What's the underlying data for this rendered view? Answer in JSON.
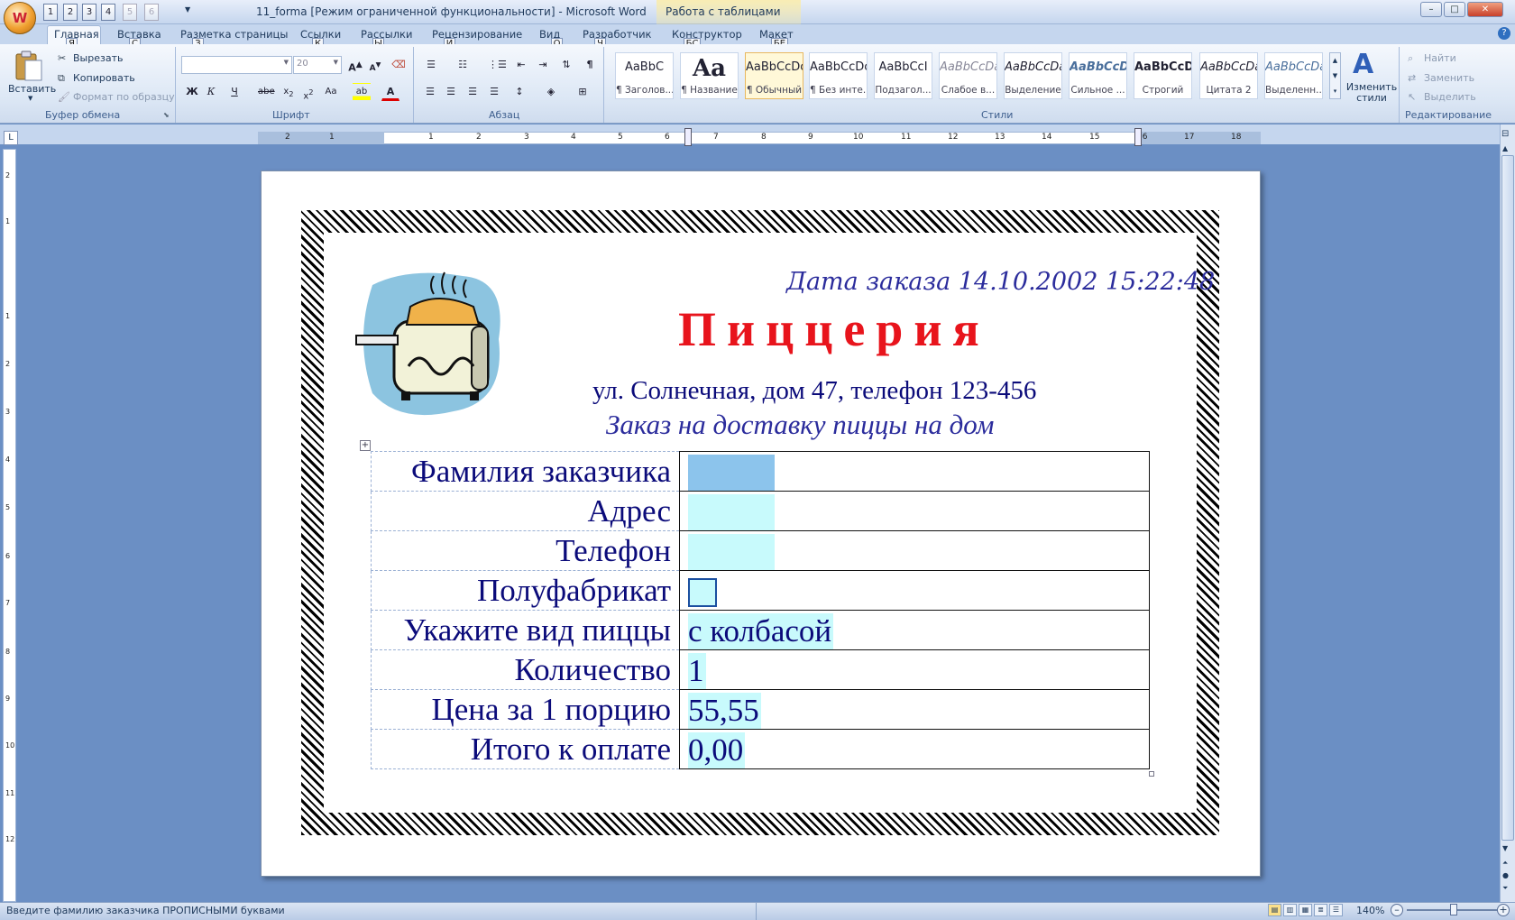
{
  "window": {
    "title": "11_forma [Режим ограниченной функциональности] - Microsoft Word",
    "context_title": "Работа с таблицами",
    "minimize": "–",
    "maximize": "□",
    "close": "✕"
  },
  "office_button": {
    "glyph": "W"
  },
  "quick_access": [
    {
      "label": "1",
      "disabled": false
    },
    {
      "label": "2",
      "disabled": false
    },
    {
      "label": "3",
      "disabled": false
    },
    {
      "label": "4",
      "disabled": false
    },
    {
      "label": "5",
      "disabled": true
    },
    {
      "label": "6",
      "disabled": true
    }
  ],
  "tabs": [
    {
      "label": "Главная",
      "key": "Я"
    },
    {
      "label": "Вставка",
      "key": "С"
    },
    {
      "label": "Разметка страницы",
      "key": "З"
    },
    {
      "label": "Ссылки",
      "key": "К"
    },
    {
      "label": "Рассылки",
      "key": "Ы"
    },
    {
      "label": "Рецензирование",
      "key": "И"
    },
    {
      "label": "Вид",
      "key": "О"
    },
    {
      "label": "Разработчик",
      "key": "Ч"
    },
    {
      "label": "Конструктор",
      "key": "БС"
    },
    {
      "label": "Макет",
      "key": "БЕ"
    }
  ],
  "clipboard": {
    "paste": "Вставить",
    "cut": "Вырезать",
    "copy": "Копировать",
    "format_painter": "Формат по образцу",
    "group": "Буфер обмена"
  },
  "font": {
    "size": "20",
    "group": "Шрифт"
  },
  "paragraph": {
    "group": "Абзац"
  },
  "styles": {
    "items": [
      {
        "preview": "AaBbC",
        "name": "¶ Заголов..."
      },
      {
        "preview": "Aa",
        "name": "¶ Название"
      },
      {
        "preview": "AaBbCcDc",
        "name": "¶ Обычный"
      },
      {
        "preview": "AaBbCcDc",
        "name": "¶ Без инте..."
      },
      {
        "preview": "AaBbCcI",
        "name": "Подзагол..."
      },
      {
        "preview": "AaBbCcDa",
        "name": "Слабое в..."
      },
      {
        "preview": "AaBbCcDa",
        "name": "Выделение"
      },
      {
        "preview": "AaBbCcDa",
        "name": "Сильное ..."
      },
      {
        "preview": "AaBbCcDd",
        "name": "Строгий"
      },
      {
        "preview": "AaBbCcDa",
        "name": "Цитата 2"
      },
      {
        "preview": "AaBbCcDa",
        "name": "Выделенн..."
      }
    ],
    "change_styles": "Изменить стили",
    "group": "Стили"
  },
  "editing": {
    "find": "Найти",
    "replace": "Заменить",
    "select": "Выделить",
    "group": "Редактирование"
  },
  "ruler": {
    "h_numbers": [
      "2",
      "1",
      "1",
      "2",
      "3",
      "4",
      "5",
      "6",
      "7",
      "8",
      "9",
      "10",
      "11",
      "12",
      "13",
      "14",
      "15",
      "16",
      "17",
      "18"
    ],
    "v_numbers": [
      "2",
      "1",
      "1",
      "2",
      "3",
      "4",
      "5",
      "6",
      "7",
      "8",
      "9",
      "10",
      "11",
      "12"
    ]
  },
  "document": {
    "date_line": "Дата заказа 14.10.2002 15:22:48",
    "title": "Пиццерия",
    "address": "ул. Солнечная, дом 47, телефон 123-456",
    "subtitle": "Заказ на  доставку пиццы на дом",
    "rows": [
      {
        "label": "Фамилия заказчика",
        "value": ""
      },
      {
        "label": "Адрес",
        "value": ""
      },
      {
        "label": "Телефон",
        "value": ""
      },
      {
        "label": "Полуфабрикат",
        "value": ""
      },
      {
        "label": "Укажите вид пиццы",
        "value": "с колбасой"
      },
      {
        "label": "Количество",
        "value": "1"
      },
      {
        "label": "Цена за 1 порцию",
        "value": "55,55"
      },
      {
        "label": "Итого к оплате",
        "value": "0,00"
      }
    ]
  },
  "status": {
    "text": "Введите фамилию заказчика ПРОПИСНЫМИ буквами",
    "zoom": "140%"
  }
}
